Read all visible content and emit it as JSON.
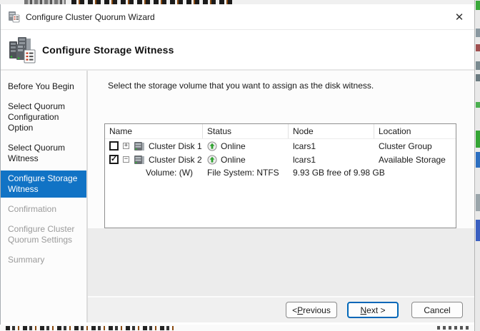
{
  "window": {
    "title": "Configure Cluster Quorum Wizard",
    "close_glyph": "✕"
  },
  "header": {
    "title": "Configure Storage Witness"
  },
  "sidebar": {
    "items": [
      {
        "label": "Before You Begin",
        "state": "done"
      },
      {
        "label": "Select Quorum Configuration Option",
        "state": "done"
      },
      {
        "label": "Select Quorum Witness",
        "state": "done"
      },
      {
        "label": "Configure Storage Witness",
        "state": "active"
      },
      {
        "label": "Confirmation",
        "state": "pending"
      },
      {
        "label": "Configure Cluster Quorum Settings",
        "state": "pending"
      },
      {
        "label": "Summary",
        "state": "pending"
      }
    ]
  },
  "main": {
    "instruction": "Select the storage volume that you want to assign as the disk witness.",
    "table": {
      "check_glyph": "✓",
      "columns": [
        "Name",
        "Status",
        "Node",
        "Location"
      ],
      "rows": [
        {
          "checked": false,
          "expander": "+",
          "name": "Cluster Disk 1",
          "status": "Online",
          "node": "lcars1",
          "location": "Cluster Group"
        },
        {
          "checked": true,
          "expander": "−",
          "name": "Cluster Disk 2",
          "status": "Online",
          "node": "lcars1",
          "location": "Available Storage",
          "detail": {
            "volume": "Volume: (W)",
            "filesystem": "File System: NTFS",
            "space": "9.93 GB free of 9.98 GB"
          }
        }
      ]
    }
  },
  "footer": {
    "previous": {
      "pre": "< ",
      "key": "P",
      "rest": "revious"
    },
    "next": {
      "pre": "",
      "key": "N",
      "rest": "ext >"
    },
    "cancel": "Cancel"
  },
  "colors": {
    "active_step_blue": "#1173c5",
    "default_button_border": "#0067b8",
    "online_green": "#2fa12f",
    "status_circle_gray": "#8a8a8a"
  }
}
